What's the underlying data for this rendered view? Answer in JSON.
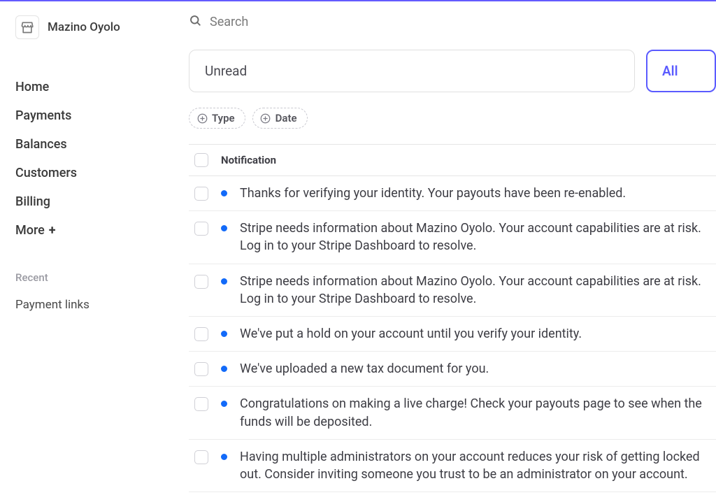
{
  "brand": {
    "name": "Mazino Oyolo"
  },
  "sidebar": {
    "items": [
      {
        "label": "Home"
      },
      {
        "label": "Payments"
      },
      {
        "label": "Balances"
      },
      {
        "label": "Customers"
      },
      {
        "label": "Billing"
      },
      {
        "label": "More"
      }
    ],
    "recent_title": "Recent",
    "recent": [
      {
        "label": "Payment links"
      }
    ]
  },
  "search": {
    "placeholder": "Search"
  },
  "tabs": {
    "unread": "Unread",
    "all": "All"
  },
  "filters": {
    "type": "Type",
    "date": "Date"
  },
  "table": {
    "header": "Notification",
    "rows": [
      {
        "text": "Thanks for verifying your identity. Your payouts have been re-enabled."
      },
      {
        "text": "Stripe needs information about Mazino Oyolo. Your account capabilities are at risk. Log in to your Stripe Dashboard to resolve."
      },
      {
        "text": "Stripe needs information about Mazino Oyolo. Your account capabilities are at risk. Log in to your Stripe Dashboard to resolve."
      },
      {
        "text": "We've put a hold on your account until you verify your identity."
      },
      {
        "text": "We've uploaded a new tax document for you."
      },
      {
        "text": "Congratulations on making a live charge! Check your payouts page to see when the funds will be deposited."
      },
      {
        "text": "Having multiple administrators on your account reduces your risk of getting locked out. Consider inviting someone you trust to be an administrator on your account."
      }
    ]
  }
}
